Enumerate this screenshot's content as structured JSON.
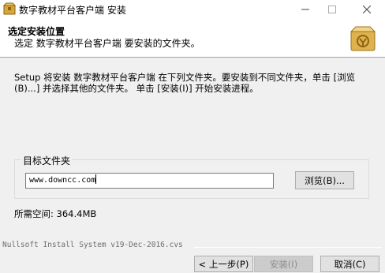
{
  "window": {
    "title": "数字教材平台客户端 安装",
    "minimize_icon": "minimize-icon",
    "maximize_icon": "maximize-icon",
    "close_icon": "close-icon"
  },
  "header": {
    "title": "选定安装位置",
    "subtitle": "选定 数字教材平台客户端 要安装的文件夹。",
    "logo_icon": "installer-box-icon"
  },
  "description": "Setup 将安装 数字教材平台客户端 在下列文件夹。要安装到不同文件夹，单击 [浏览(B)...] 并选择其他的文件夹。 单击 [安装(I)] 开始安装进程。",
  "destination": {
    "group_label": "目标文件夹",
    "path_value": "www.downcc.com",
    "browse_label": "浏览(B)..."
  },
  "space_required": "所需空间: 364.4MB",
  "footer": {
    "brand": "Nullsoft Install System v19-Dec-2016.cvs",
    "back_label": "< 上一步(P)",
    "install_label": "安装(I)",
    "cancel_label": "取消(C)"
  }
}
